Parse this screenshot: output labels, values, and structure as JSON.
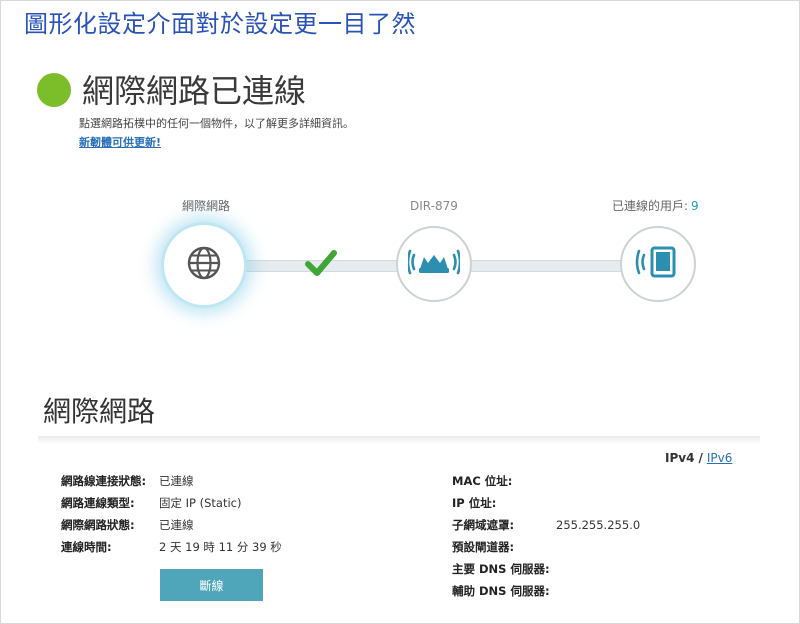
{
  "caption": "圖形化設定介面對於設定更一目了然",
  "status": {
    "title": "網際網路已連線",
    "hint": "點選網路拓樸中的任何一個物件，以了解更多詳細資訊。",
    "firmware_link": "新韌體可供更新!",
    "dot_color": "#7cbd2a"
  },
  "topology": {
    "internet_label": "網際網路",
    "router_label": "DIR-879",
    "clients_label": "已連線的用戶:",
    "clients_count": "9",
    "icons": [
      "globe-icon",
      "router-icon",
      "device-icon",
      "check-icon"
    ]
  },
  "section": {
    "title": "網際網路",
    "ipv4": "IPv4",
    "separator": "/",
    "ipv6": "IPv6"
  },
  "left_info": [
    {
      "key": "網路線連接狀態:",
      "value": "已連線"
    },
    {
      "key": "網路連線類型:",
      "value": "固定 IP (Static)"
    },
    {
      "key": "網際網路狀態:",
      "value": "已連線"
    },
    {
      "key": "連線時間:",
      "value": "2 天 19 時 11 分 39 秒"
    }
  ],
  "right_info": [
    {
      "key": "MAC 位址:",
      "value": ""
    },
    {
      "key": "IP 位址:",
      "value": ""
    },
    {
      "key": "子網域遮罩:",
      "value": "255.255.255.0"
    },
    {
      "key": "預設閘道器:",
      "value": ""
    },
    {
      "key": "主要 DNS 伺服器:",
      "value": ""
    },
    {
      "key": "輔助 DNS 伺服器:",
      "value": ""
    }
  ],
  "disconnect_label": "斷線",
  "colors": {
    "accent": "#1a9fc0",
    "button": "#4fa5b9",
    "check": "#3fa535",
    "link": "#2a6fb8"
  }
}
